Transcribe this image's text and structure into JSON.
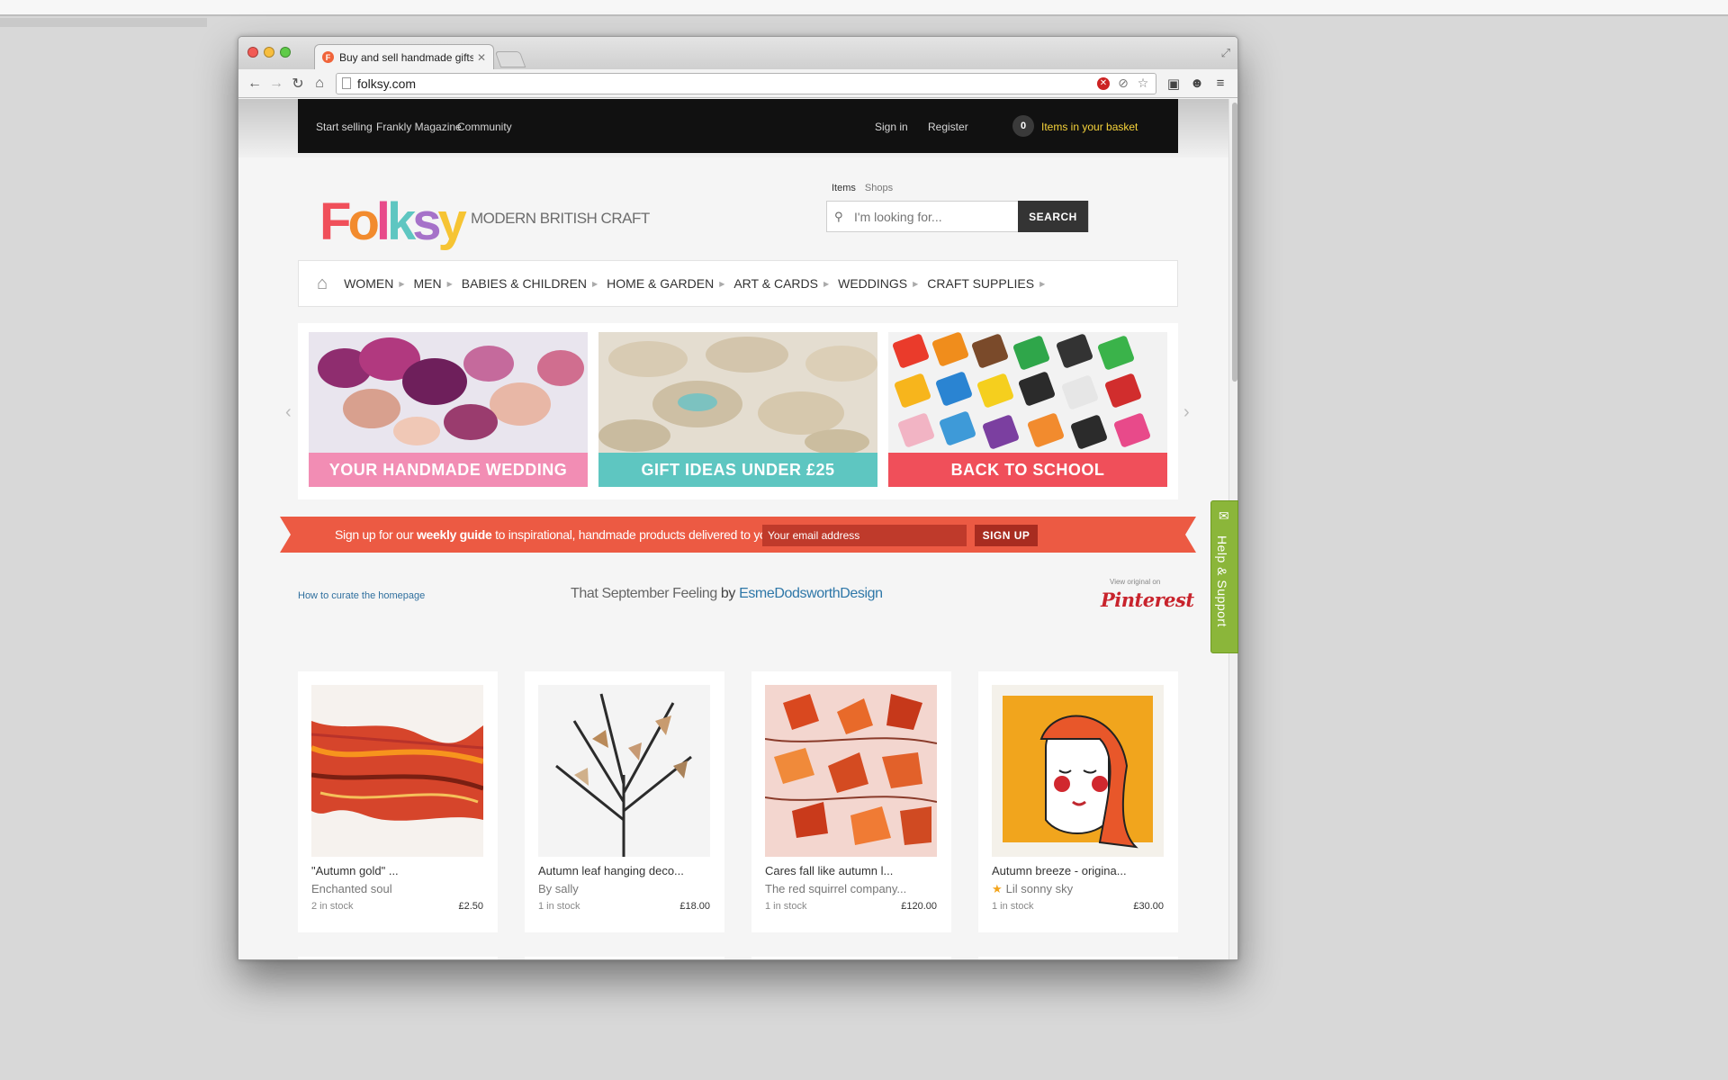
{
  "browser": {
    "tab_title": "Buy and sell handmade gifts",
    "tab_favicon": "F",
    "url": "folksy.com"
  },
  "topbar": {
    "start_selling": "Start selling",
    "magazine": "Frankly Magazine",
    "community": "Community",
    "sign_in": "Sign in",
    "register": "Register",
    "basket_count": "0",
    "basket_label": "Items in your basket"
  },
  "header": {
    "logo_text": "Folksy",
    "tagline": "MODERN BRITISH CRAFT",
    "search_tab_items": "Items",
    "search_tab_shops": "Shops",
    "search_placeholder": "I'm looking for...",
    "search_button": "SEARCH"
  },
  "nav": {
    "categories": [
      "WOMEN",
      "MEN",
      "BABIES & CHILDREN",
      "HOME & GARDEN",
      "ART & CARDS",
      "WEDDINGS",
      "CRAFT SUPPLIES"
    ]
  },
  "banners": [
    {
      "label": "YOUR HANDMADE WEDDING",
      "color": "#f28db4"
    },
    {
      "label": "GIFT IDEAS UNDER £25",
      "color": "#5ec6c1"
    },
    {
      "label": "BACK TO SCHOOL",
      "color": "#f04f5a"
    }
  ],
  "signup": {
    "text_before": "Sign up for our ",
    "text_bold": "weekly guide",
    "text_after": " to inspirational, handmade products delivered to your inbox",
    "email_placeholder": "Your email address",
    "button": "SIGN UP"
  },
  "curation": {
    "how_to_link": "How to curate the homepage",
    "board_title": "That September Feeling",
    "by": "by",
    "author": "EsmeDodsworthDesign",
    "view_original": "View original on",
    "pinterest": "Pinterest"
  },
  "products": [
    {
      "title": "\"Autumn gold\" ...",
      "shop": "Enchanted soul",
      "stock": "2 in stock",
      "price": "£2.50",
      "starred": false
    },
    {
      "title": "Autumn leaf hanging deco...",
      "shop": "By sally",
      "stock": "1 in stock",
      "price": "£18.00",
      "starred": false
    },
    {
      "title": "Cares fall like autumn l...",
      "shop": "The red squirrel company...",
      "stock": "1 in stock",
      "price": "£120.00",
      "starred": false
    },
    {
      "title": "Autumn breeze - origina...",
      "shop": "Lil sonny sky",
      "stock": "1 in stock",
      "price": "£30.00",
      "starred": true
    }
  ],
  "help_tab": {
    "label": "Help & Support"
  },
  "colors": {
    "topbar_bg": "#111111",
    "basket_text": "#f6d33a",
    "ribbon": "#ec5a43",
    "link_blue": "#2e77a8",
    "pinterest_red": "#c8232c",
    "help_green": "#8bb63a"
  },
  "icons": [
    "back-icon",
    "forward-icon",
    "reload-icon",
    "home-icon",
    "page-icon",
    "stop-icon",
    "star-icon",
    "menu-icon",
    "search-icon",
    "gear-icon"
  ]
}
